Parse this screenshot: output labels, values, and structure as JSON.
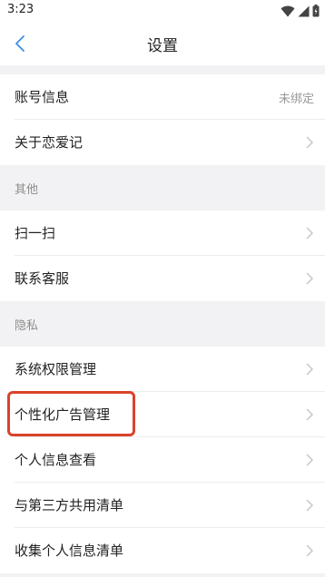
{
  "status_bar": {
    "time": "3:23",
    "icons": [
      "wifi-icon",
      "signal-icon",
      "battery-icon"
    ]
  },
  "header": {
    "title": "设置",
    "back_icon": "chevron-left-icon"
  },
  "account_section": {
    "items": [
      {
        "label": "账号信息",
        "value": "未绑定"
      },
      {
        "label": "关于恋爱记"
      }
    ]
  },
  "other_section": {
    "title": "其他",
    "items": [
      {
        "label": "扫一扫"
      },
      {
        "label": "联系客服"
      }
    ]
  },
  "privacy_section": {
    "title": "隐私",
    "items": [
      {
        "label": "系统权限管理"
      },
      {
        "label": "个性化广告管理"
      },
      {
        "label": "个人信息查看"
      },
      {
        "label": "与第三方共用清单"
      },
      {
        "label": "收集个人信息清单"
      }
    ]
  },
  "colors": {
    "accent": "#3a8ee6",
    "highlight": "#d9432b",
    "background": "#f2f2f4"
  }
}
